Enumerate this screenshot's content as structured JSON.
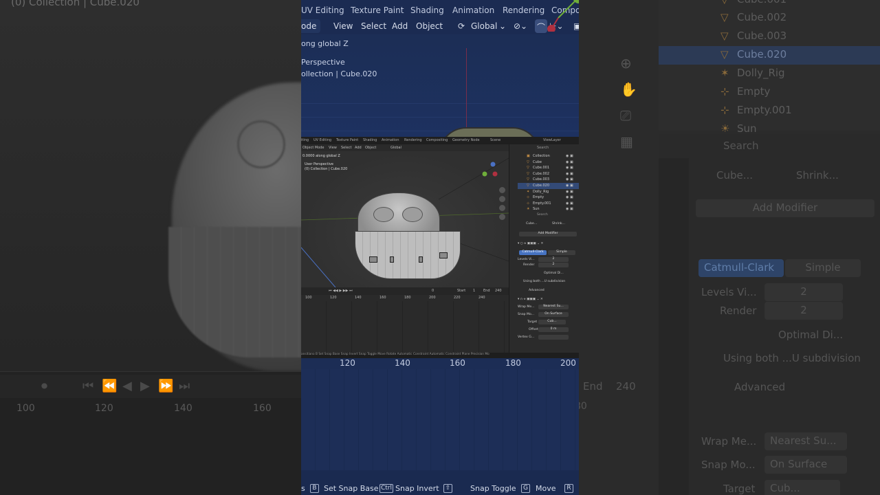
{
  "left_bg": {
    "title": "(0) Collection | Cube.020",
    "timeline_numbers": [
      "100",
      "120",
      "140",
      "160"
    ],
    "controls": [
      "⏺",
      "⏮",
      "⏪",
      "◀",
      "▶",
      "⏩",
      "⏭"
    ]
  },
  "right_bg": {
    "outliner_rows": [
      {
        "name": "Cube.001",
        "selected": false
      },
      {
        "name": "Cube.002",
        "selected": false
      },
      {
        "name": "Cube.003",
        "selected": false
      },
      {
        "name": "Cube.020",
        "selected": true
      },
      {
        "name": "Dolly_Rig",
        "selected": false
      },
      {
        "name": "Empty",
        "selected": false
      },
      {
        "name": "Empty.001",
        "selected": false
      },
      {
        "name": "Sun",
        "selected": false
      }
    ],
    "search_placeholder": "Search",
    "breadcrumb_object": "Cube...",
    "breadcrumb_modifier": "Shrink...",
    "add_modifier": "Add Modifier",
    "catmull": "Catmull-Clark",
    "simple": "Simple",
    "levels_label": "Levels Vi...",
    "levels_value": "2",
    "render_label": "Render",
    "render_value": "2",
    "optimal": "Optimal Di...",
    "using_both": "Using both ...U subdivision",
    "advanced": "Advanced",
    "wrap_label": "Wrap Me...",
    "wrap_value": "Nearest Su...",
    "snap_label": "Snap Mo...",
    "snap_value": "On Surface",
    "target_label": "Target",
    "target_value": "Cub...",
    "end_label": "End",
    "end_value": "240",
    "timeline_number": "80"
  },
  "top": {
    "menu": [
      "UV Editing",
      "Texture Paint",
      "Shading",
      "Animation",
      "Rendering",
      "Compo"
    ],
    "header": [
      "ode",
      "View",
      "Select",
      "Add",
      "Object"
    ],
    "orientation": "Global",
    "overlay_line1": "ong global Z",
    "overlay_line2": "Perspective",
    "overlay_line3": "ollection | Cube.020",
    "gizmo_y": "Y"
  },
  "shot": {
    "menu": [
      "iting",
      "UV Editing",
      "Texture Paint",
      "Shading",
      "Animation",
      "Rendering",
      "Compositing",
      "Geometry Node"
    ],
    "scene": "Scene",
    "viewlayer": "ViewLayer",
    "header": [
      "Object Mode",
      "View",
      "Select",
      "Add",
      "Object",
      "Global"
    ],
    "overlay_line1": "0.0000 along global Z",
    "overlay_line2": "User Perspective",
    "overlay_line3": "(0) Collection | Cube.020",
    "outliner": [
      {
        "name": "Collection",
        "selected": false
      },
      {
        "name": "Cube",
        "selected": false
      },
      {
        "name": "Cube.001",
        "selected": false
      },
      {
        "name": "Cube.002",
        "selected": false
      },
      {
        "name": "Cube.003",
        "selected": false
      },
      {
        "name": "Cube.020",
        "selected": true
      },
      {
        "name": "Dolly_Rig",
        "selected": false
      },
      {
        "name": "Empty",
        "selected": false
      },
      {
        "name": "Empty.001",
        "selected": false
      },
      {
        "name": "Sun",
        "selected": false
      }
    ],
    "search": "Search",
    "breadcrumb_object": "Cube...",
    "breadcrumb_modifier": "Shrink...",
    "add_modifier": "Add Modifier",
    "catmull": "Catmull-Clark",
    "simple": "Simple",
    "levels_label": "Levels Vi...",
    "levels_value": "2",
    "render_label": "Render",
    "render_value": "2",
    "optimal": "Optimal Di...",
    "using_both": "Using both ...U subdivision",
    "advanced": "Advanced",
    "wrap_label": "Wrap Me...",
    "wrap_value": "Nearest Su...",
    "snap_label": "Snap Mo...",
    "snap_value": "On Surface",
    "target_label": "Target",
    "target_value": "Cub...",
    "offset_label": "Offset",
    "offset_value": "0 m",
    "vertex_label": "Vertex G...",
    "timeline_frame": "0",
    "start_label": "Start",
    "start_value": "1",
    "end_label": "End",
    "end_value": "240",
    "timeline_numbers": [
      "100",
      "120",
      "140",
      "160",
      "180",
      "200",
      "220",
      "240"
    ],
    "status": "ansitiano  B Set Snap Base   Snap Invert   Snap Toggle   Move   Rotate   Automatic Constraint   Automatic Constraint Plane   Precision Mo"
  },
  "bottom": {
    "numbers": [
      "120",
      "140",
      "160",
      "180",
      "200"
    ],
    "status": [
      {
        "key": "B",
        "label": "Set Snap Base"
      },
      {
        "key": "Ctrl",
        "label": "Snap Invert"
      },
      {
        "key": "⇧",
        "label": "Snap Toggle"
      },
      {
        "key": "G",
        "label": "Move"
      },
      {
        "key": "R",
        "label": ""
      }
    ],
    "lead": "s"
  },
  "colors": {
    "selection": "#334a77",
    "accent_blue": "#4673c2",
    "object_orange": "#e0a04a",
    "tint": "#1c2d55"
  }
}
